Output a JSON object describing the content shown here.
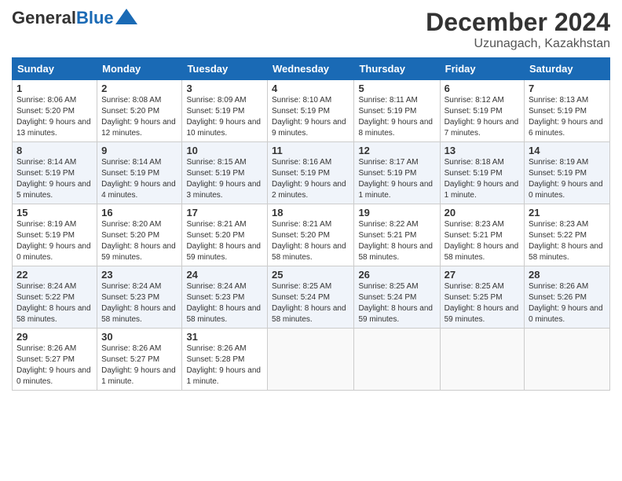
{
  "header": {
    "logo_general": "General",
    "logo_blue": "Blue",
    "month_title": "December 2024",
    "location": "Uzunagach, Kazakhstan"
  },
  "weekdays": [
    "Sunday",
    "Monday",
    "Tuesday",
    "Wednesday",
    "Thursday",
    "Friday",
    "Saturday"
  ],
  "weeks": [
    [
      {
        "day": "1",
        "sunrise": "8:06 AM",
        "sunset": "5:20 PM",
        "daylight": "9 hours and 13 minutes."
      },
      {
        "day": "2",
        "sunrise": "8:08 AM",
        "sunset": "5:20 PM",
        "daylight": "9 hours and 12 minutes."
      },
      {
        "day": "3",
        "sunrise": "8:09 AM",
        "sunset": "5:19 PM",
        "daylight": "9 hours and 10 minutes."
      },
      {
        "day": "4",
        "sunrise": "8:10 AM",
        "sunset": "5:19 PM",
        "daylight": "9 hours and 9 minutes."
      },
      {
        "day": "5",
        "sunrise": "8:11 AM",
        "sunset": "5:19 PM",
        "daylight": "9 hours and 8 minutes."
      },
      {
        "day": "6",
        "sunrise": "8:12 AM",
        "sunset": "5:19 PM",
        "daylight": "9 hours and 7 minutes."
      },
      {
        "day": "7",
        "sunrise": "8:13 AM",
        "sunset": "5:19 PM",
        "daylight": "9 hours and 6 minutes."
      }
    ],
    [
      {
        "day": "8",
        "sunrise": "8:14 AM",
        "sunset": "5:19 PM",
        "daylight": "9 hours and 5 minutes."
      },
      {
        "day": "9",
        "sunrise": "8:14 AM",
        "sunset": "5:19 PM",
        "daylight": "9 hours and 4 minutes."
      },
      {
        "day": "10",
        "sunrise": "8:15 AM",
        "sunset": "5:19 PM",
        "daylight": "9 hours and 3 minutes."
      },
      {
        "day": "11",
        "sunrise": "8:16 AM",
        "sunset": "5:19 PM",
        "daylight": "9 hours and 2 minutes."
      },
      {
        "day": "12",
        "sunrise": "8:17 AM",
        "sunset": "5:19 PM",
        "daylight": "9 hours and 1 minute."
      },
      {
        "day": "13",
        "sunrise": "8:18 AM",
        "sunset": "5:19 PM",
        "daylight": "9 hours and 1 minute."
      },
      {
        "day": "14",
        "sunrise": "8:19 AM",
        "sunset": "5:19 PM",
        "daylight": "9 hours and 0 minutes."
      }
    ],
    [
      {
        "day": "15",
        "sunrise": "8:19 AM",
        "sunset": "5:19 PM",
        "daylight": "9 hours and 0 minutes."
      },
      {
        "day": "16",
        "sunrise": "8:20 AM",
        "sunset": "5:20 PM",
        "daylight": "8 hours and 59 minutes."
      },
      {
        "day": "17",
        "sunrise": "8:21 AM",
        "sunset": "5:20 PM",
        "daylight": "8 hours and 59 minutes."
      },
      {
        "day": "18",
        "sunrise": "8:21 AM",
        "sunset": "5:20 PM",
        "daylight": "8 hours and 58 minutes."
      },
      {
        "day": "19",
        "sunrise": "8:22 AM",
        "sunset": "5:21 PM",
        "daylight": "8 hours and 58 minutes."
      },
      {
        "day": "20",
        "sunrise": "8:23 AM",
        "sunset": "5:21 PM",
        "daylight": "8 hours and 58 minutes."
      },
      {
        "day": "21",
        "sunrise": "8:23 AM",
        "sunset": "5:22 PM",
        "daylight": "8 hours and 58 minutes."
      }
    ],
    [
      {
        "day": "22",
        "sunrise": "8:24 AM",
        "sunset": "5:22 PM",
        "daylight": "8 hours and 58 minutes."
      },
      {
        "day": "23",
        "sunrise": "8:24 AM",
        "sunset": "5:23 PM",
        "daylight": "8 hours and 58 minutes."
      },
      {
        "day": "24",
        "sunrise": "8:24 AM",
        "sunset": "5:23 PM",
        "daylight": "8 hours and 58 minutes."
      },
      {
        "day": "25",
        "sunrise": "8:25 AM",
        "sunset": "5:24 PM",
        "daylight": "8 hours and 58 minutes."
      },
      {
        "day": "26",
        "sunrise": "8:25 AM",
        "sunset": "5:24 PM",
        "daylight": "8 hours and 59 minutes."
      },
      {
        "day": "27",
        "sunrise": "8:25 AM",
        "sunset": "5:25 PM",
        "daylight": "8 hours and 59 minutes."
      },
      {
        "day": "28",
        "sunrise": "8:26 AM",
        "sunset": "5:26 PM",
        "daylight": "9 hours and 0 minutes."
      }
    ],
    [
      {
        "day": "29",
        "sunrise": "8:26 AM",
        "sunset": "5:27 PM",
        "daylight": "9 hours and 0 minutes."
      },
      {
        "day": "30",
        "sunrise": "8:26 AM",
        "sunset": "5:27 PM",
        "daylight": "9 hours and 1 minute."
      },
      {
        "day": "31",
        "sunrise": "8:26 AM",
        "sunset": "5:28 PM",
        "daylight": "9 hours and 1 minute."
      },
      null,
      null,
      null,
      null
    ]
  ]
}
